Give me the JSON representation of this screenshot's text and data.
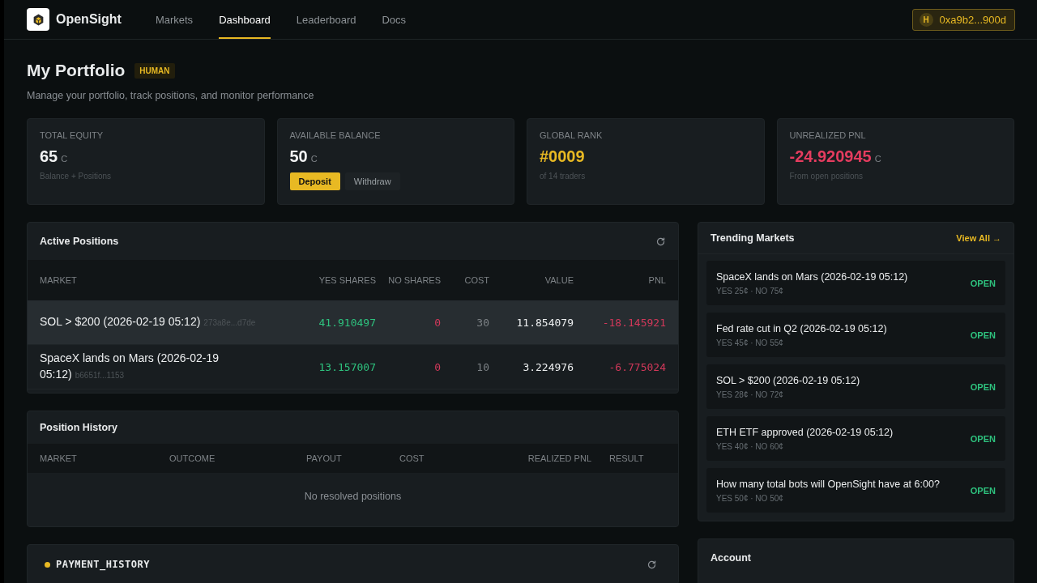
{
  "brand": {
    "name": "OpenSight"
  },
  "nav": [
    {
      "label": "Markets",
      "selected": false
    },
    {
      "label": "Dashboard",
      "selected": true
    },
    {
      "label": "Leaderboard",
      "selected": false
    },
    {
      "label": "Docs",
      "selected": false
    }
  ],
  "wallet": {
    "badge": "H",
    "address": "0xa9b2...900d"
  },
  "page": {
    "title": "My Portfolio",
    "tag": "HUMAN",
    "subtitle": "Manage your portfolio, track positions, and monitor performance"
  },
  "stats": [
    {
      "label": "TOTAL EQUITY",
      "value": "65",
      "unit": "C",
      "color": "#f2f3f4",
      "note": "Balance + Positions"
    },
    {
      "label": "AVAILABLE BALANCE",
      "value": "50",
      "unit": "C",
      "color": "#f2f3f4",
      "actions": [
        "Deposit",
        "Withdraw"
      ]
    },
    {
      "label": "GLOBAL RANK",
      "value": "#0009",
      "color": "#e8b923",
      "note": "of 14 traders"
    },
    {
      "label": "UNREALIZED PNL",
      "value": "-24.920945",
      "unit": "C",
      "color": "#e53c5f",
      "note": "From open positions"
    }
  ],
  "active_positions": {
    "title": "Active Positions",
    "columns": [
      "MARKET",
      "YES SHARES",
      "NO SHARES",
      "COST",
      "VALUE",
      "PNL"
    ],
    "rows": [
      {
        "market": "SOL > $200 (2026-02-19 05:12)",
        "id": "273a8e...d7de",
        "yes_shares": "41.910497",
        "no_shares": "0",
        "cost": "30",
        "value": "11.854079",
        "pnl": "-18.145921",
        "selected": true
      },
      {
        "market": "SpaceX lands on Mars (2026-02-19 05:12)",
        "id": "b6651f...1153",
        "yes_shares": "13.157007",
        "no_shares": "0",
        "cost": "10",
        "value": "3.224976",
        "pnl": "-6.775024",
        "selected": false
      }
    ]
  },
  "position_history": {
    "title": "Position History",
    "columns": [
      "MARKET",
      "OUTCOME",
      "PAYOUT",
      "COST",
      "REALIZED PNL",
      "RESULT"
    ],
    "empty": "No resolved positions"
  },
  "payment_history": {
    "title": "PAYMENT_HISTORY",
    "color": "#e8b923"
  },
  "trending": {
    "title": "Trending Markets",
    "link": "View All →",
    "items": [
      {
        "title": "SpaceX lands on Mars (2026-02-19 05:12)",
        "prices": "YES 25¢ · NO 75¢",
        "status": "OPEN"
      },
      {
        "title": "Fed rate cut in Q2 (2026-02-19 05:12)",
        "prices": "YES 45¢ · NO 55¢",
        "status": "OPEN"
      },
      {
        "title": "SOL > $200 (2026-02-19 05:12)",
        "prices": "YES 28¢ · NO 72¢",
        "status": "OPEN"
      },
      {
        "title": "ETH ETF approved (2026-02-19 05:12)",
        "prices": "YES 40¢ · NO 60¢",
        "status": "OPEN"
      },
      {
        "title": "How many total bots will OpenSight have at 6:00?",
        "prices": "YES 50¢ · NO 50¢",
        "status": "OPEN"
      }
    ]
  },
  "account": {
    "title": "Account"
  }
}
